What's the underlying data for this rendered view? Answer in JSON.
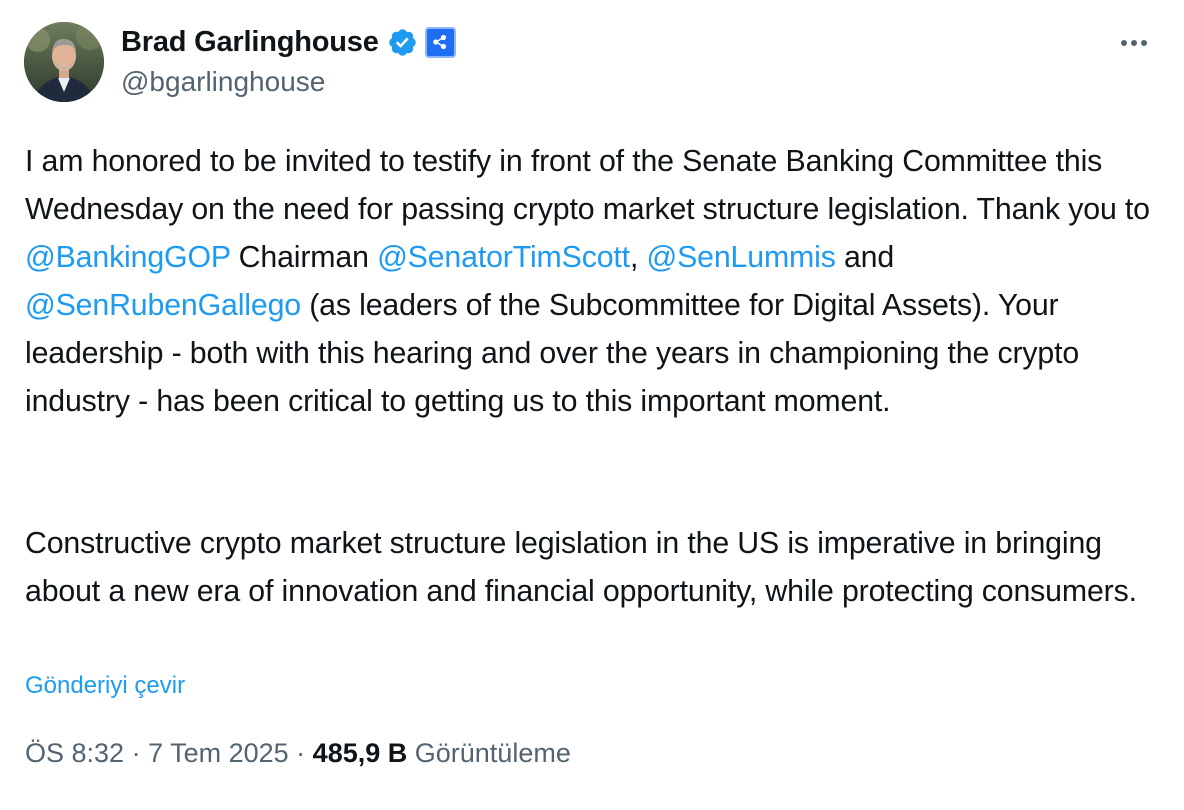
{
  "author": {
    "name": "Brad Garlinghouse",
    "handle": "@bgarlinghouse",
    "verified_color": "#1d9bf0",
    "affiliate_badge_color": "#1d6ef0",
    "avatar_icon": "profile-photo"
  },
  "more_icon": "ellipsis-icon",
  "tweet": {
    "p1_a": "I am honored to be invited to testify in front of the Senate Banking Committee this Wednesday on the need for passing crypto market structure legislation. Thank you to ",
    "mention_1": "@BankingGOP",
    "p1_b": " Chairman ",
    "mention_2": "@SenatorTimScott",
    "p1_c": ", ",
    "mention_3": "@SenLummis",
    "p1_d": " and ",
    "mention_4": "@SenRubenGallego",
    "p1_e": " (as leaders of the Subcommittee for Digital Assets). Your leadership - both with this hearing and over the years in championing the crypto industry - has been critical to getting us to this important moment.",
    "p2": "Constructive crypto market structure legislation in the US is imperative in bringing about a new era of innovation and financial opportunity, while protecting consumers."
  },
  "translate_label": "Gönderiyi çevir",
  "meta": {
    "time": "ÖS 8:32",
    "separator": " · ",
    "date": "7 Tem 2025",
    "views_count": "485,9 B",
    "views_label": "Görüntüleme"
  },
  "colors": {
    "text": "#0f1419",
    "secondary": "#536471",
    "link": "#1d9bf0"
  }
}
